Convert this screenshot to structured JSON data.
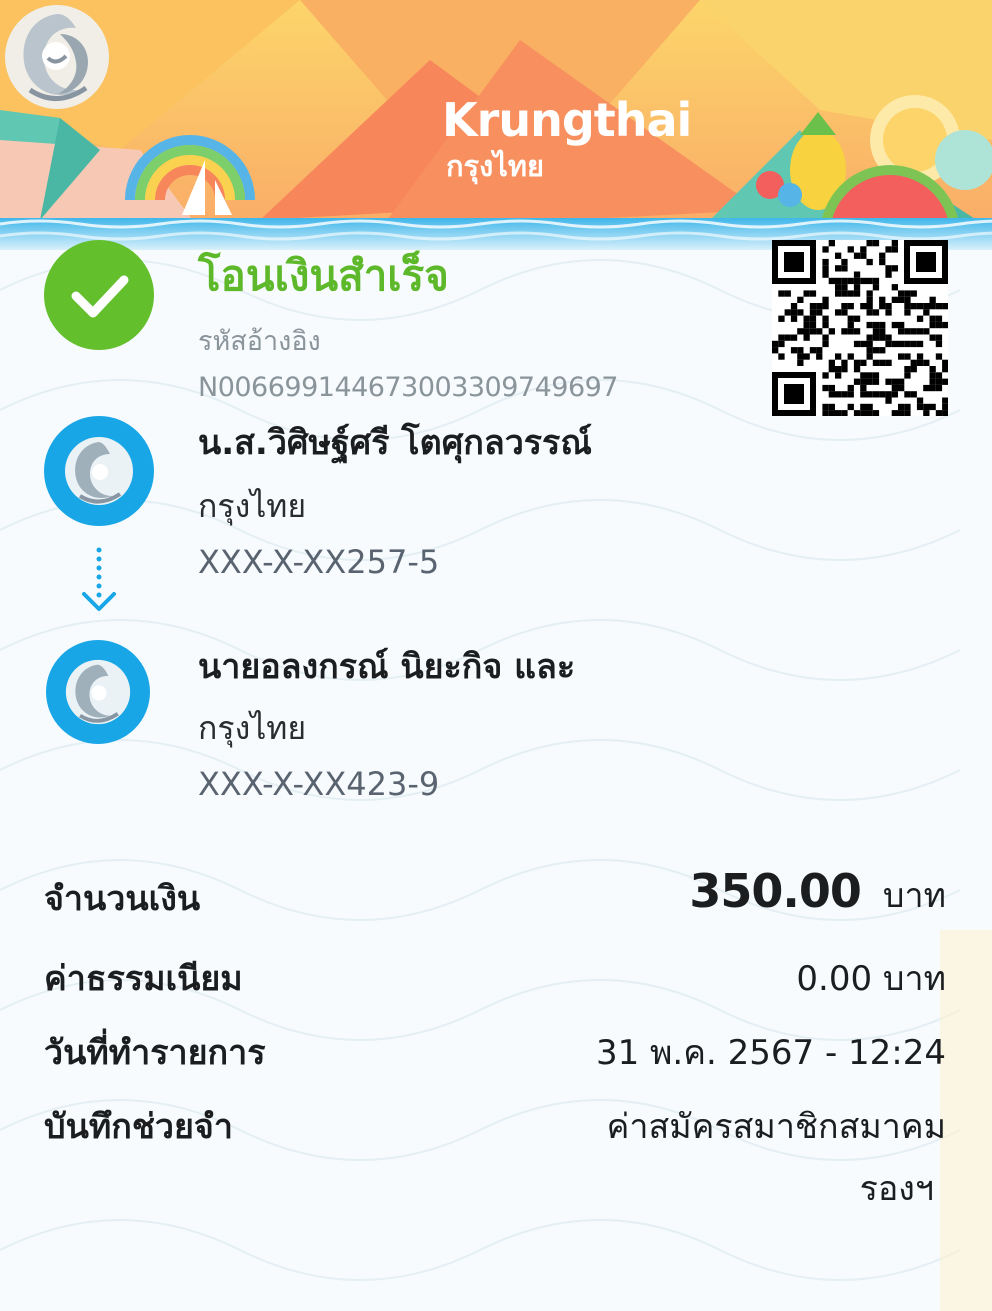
{
  "brand": {
    "name": "Krungthai",
    "name_thai": "กรุงไทย"
  },
  "status": {
    "title": "โอนเงินสำเร็จ",
    "ref_label": "รหัสอ้างอิง",
    "ref_value": "N006699144673003309749697",
    "color": "#63bf2c"
  },
  "sender": {
    "name": "น.ส.วิศิษฐ์ศรี โตศุกลวรรณ์",
    "bank": "กรุงไทย",
    "account": "XXX-X-XX257-5"
  },
  "receiver": {
    "name": "นายอลงกรณ์ นิยะกิจ และ",
    "bank": "กรุงไทย",
    "account": "XXX-X-XX423-9"
  },
  "summary": {
    "amount_label": "จำนวนเงิน",
    "amount_value": "350.00",
    "amount_unit": "บาท",
    "fee_label": "ค่าธรรมเนียม",
    "fee_value": "0.00 บาท",
    "date_label": "วันที่ทำรายการ",
    "date_value": "31 พ.ค. 2567 - 12:24",
    "memo_label": "บันทึกช่วยจำ",
    "memo_line1": "ค่าสมัครสมาชิกสมาคม",
    "memo_line2": "รองฯ"
  },
  "colors": {
    "bank_blue": "#19a6e6",
    "success_green": "#5db82a",
    "banner_orange": "#f7875a"
  }
}
